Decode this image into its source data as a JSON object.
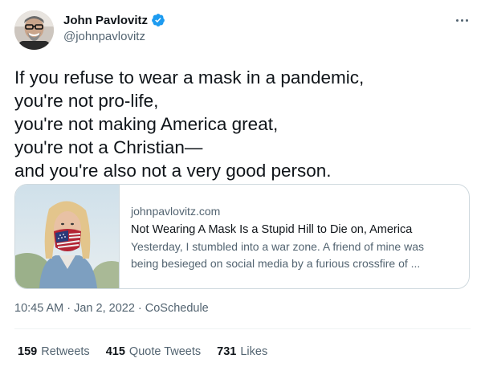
{
  "author": {
    "display_name": "John Pavlovitz",
    "handle": "@johnpavlovitz",
    "verified_icon": "verified-badge-icon",
    "avatar": "avatar-photo"
  },
  "colors": {
    "verified": "#1d9bf0",
    "text_primary": "#0f1419",
    "text_secondary": "#536471",
    "border": "#cfd9de"
  },
  "tweet": {
    "text": "If you refuse to wear a mask in a pandemic,\nyou're not pro-life,\nyou're not making America great,\nyou're not a Christian—\nand you're also not a very good person."
  },
  "link_card": {
    "domain": "johnpavlovitz.com",
    "title": "Not Wearing A Mask Is a Stupid Hill to Die on, America",
    "description": "Yesterday, I stumbled into a war zone. A friend of mine was\nbeing besieged on social media by a furious crossfire of ..."
  },
  "meta": {
    "time": "10:45 AM",
    "separator1": "·",
    "date": "Jan 2, 2022",
    "separator2": "·",
    "source": "CoSchedule"
  },
  "stats": {
    "retweets_count": "159",
    "retweets_label": "Retweets",
    "quotes_count": "415",
    "quotes_label": "Quote Tweets",
    "likes_count": "731",
    "likes_label": "Likes"
  }
}
